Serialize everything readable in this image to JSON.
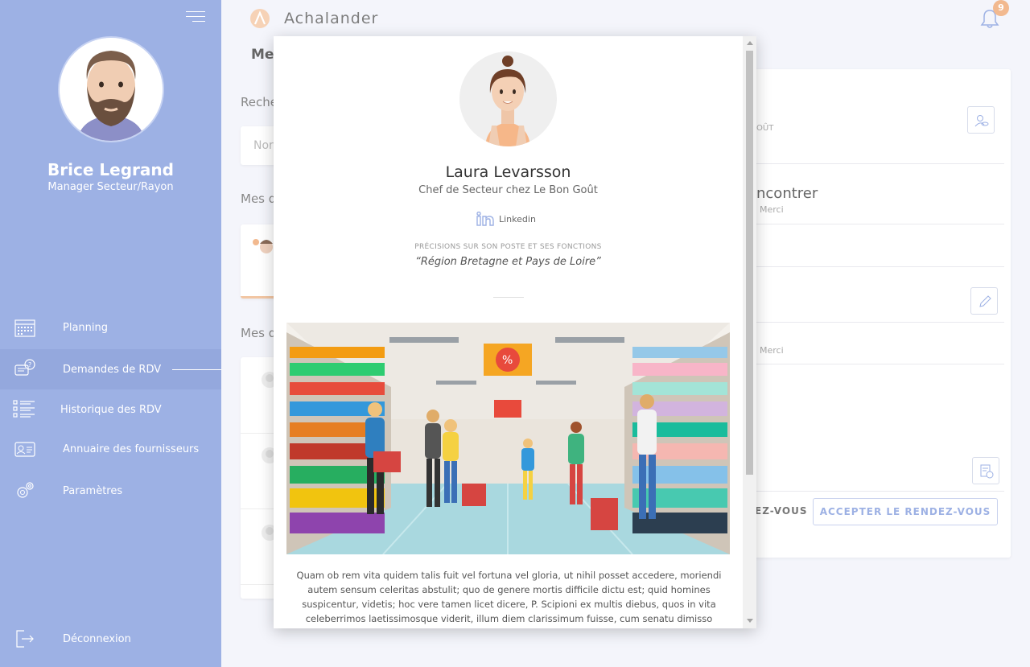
{
  "app": {
    "brand": "Achalander",
    "notifications_count": "9"
  },
  "user": {
    "name": "Brice Legrand",
    "role": "Manager Secteur/Rayon"
  },
  "nav": [
    {
      "label": "Planning",
      "icon": "calendar-icon"
    },
    {
      "label": "Demandes de RDV",
      "icon": "chat-question-icon",
      "active": true
    },
    {
      "label": "Historique des RDV",
      "icon": "list-icon"
    },
    {
      "label": "Annuaire des fournisseurs",
      "icon": "contact-card-icon"
    },
    {
      "label": "Paramètres",
      "icon": "gear-icon"
    }
  ],
  "logout_label": "Déconnexion",
  "background": {
    "page_title": "Me",
    "search_label": "Reche",
    "search_placeholder": "Nor",
    "section1_label": "Mes d",
    "section2_label": "Mes d",
    "right_panel": {
      "snippet_top": "OÛT",
      "heading_partial": "ncontrer",
      "sub_partial_1": "Merci",
      "sub_partial_2": "Merci",
      "refuse_partial": "EZ-VOUS",
      "accept_label": "ACCEPTER LE RENDEZ-VOUS"
    }
  },
  "modal": {
    "name": "Laura Levarsson",
    "role": "Chef de Secteur chez Le Bon Goût",
    "linkedin_label": "Linkedin",
    "precision_label": "PRÉCISIONS SUR SON POSTE ET SES FONCTIONS",
    "precision_text": "“Région Bretagne et Pays de Loire”",
    "description": "Quam ob rem vita quidem talis fuit vel fortuna vel gloria, ut nihil posset accedere, moriendi autem sensum celeritas abstulit; quo de genere mortis difficile dictu est; quid homines suspicentur, videtis; hoc vere tamen licet dicere, P. Scipioni ex multis diebus, quos in vita celeberrimos laetissimosque viderit, illum diem clarissimum fuisse, cum senatu dimisso"
  },
  "colors": {
    "sidebar": "#9db1e4",
    "accent": "#9db1e4",
    "badge": "#f2b98f"
  }
}
